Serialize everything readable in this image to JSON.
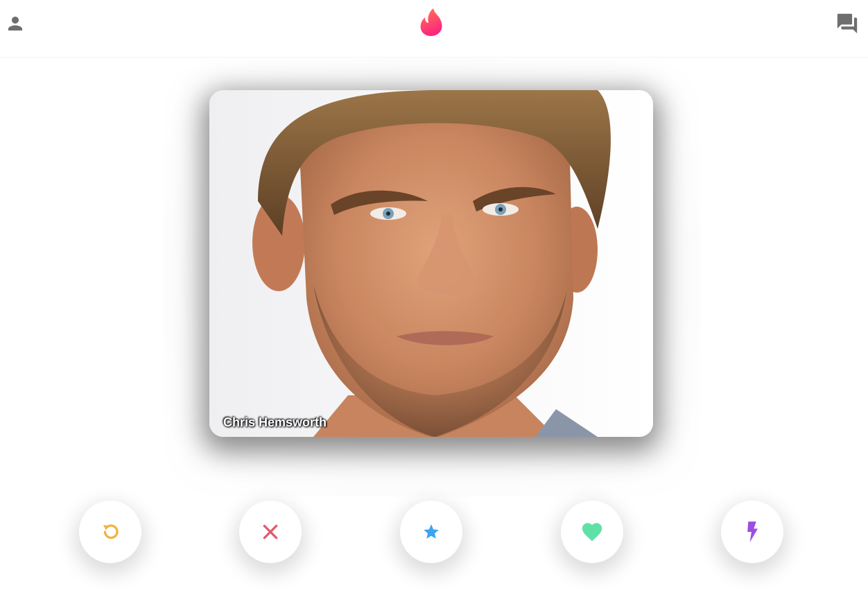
{
  "header": {
    "profile_icon": "person-icon",
    "logo_icon": "flame-logo-icon",
    "chat_icon": "forum-icon"
  },
  "card": {
    "name": "Chris Hemsworth",
    "photo": "portrait-photo"
  },
  "actions": [
    {
      "name": "rewind",
      "icon": "rewind-icon",
      "color": "#f0b33c"
    },
    {
      "name": "nope",
      "icon": "close-icon",
      "color": "#e05a6b"
    },
    {
      "name": "super-like",
      "icon": "star-icon",
      "color": "#3ba5f0"
    },
    {
      "name": "like",
      "icon": "heart-icon",
      "color": "#5fe0a7"
    },
    {
      "name": "boost",
      "icon": "lightning-icon",
      "color": "#9a4fe0"
    }
  ],
  "colors": {
    "brand_gradient_start": "#fd267d",
    "brand_gradient_end": "#ff7854",
    "header_icon": "#6e6e6e"
  }
}
